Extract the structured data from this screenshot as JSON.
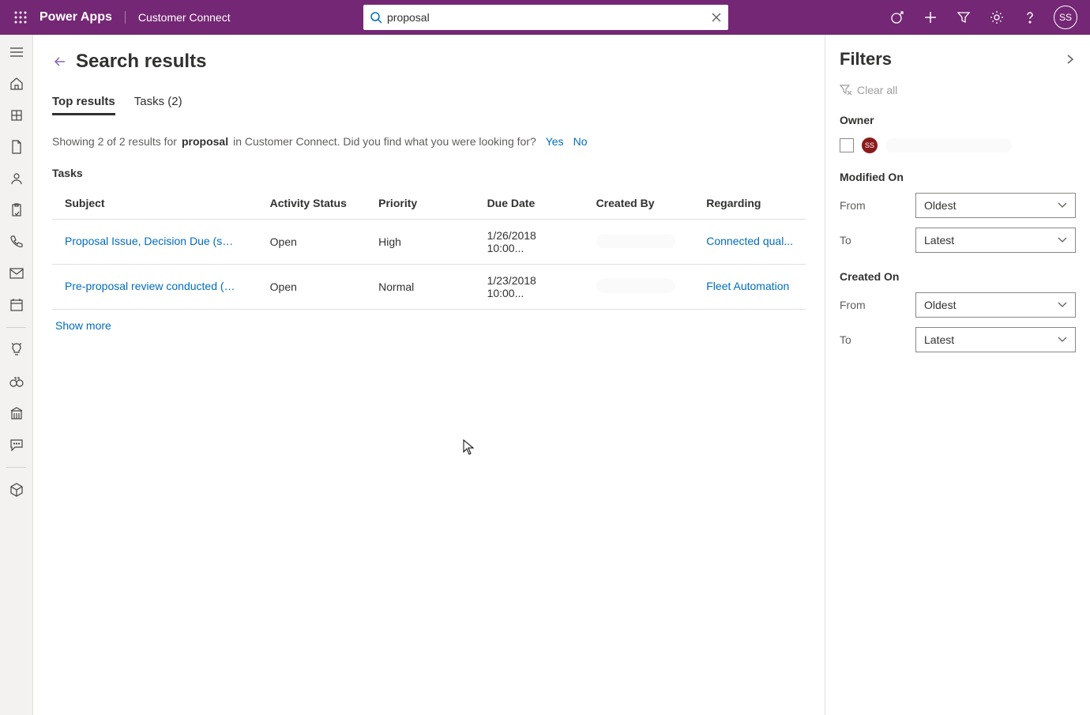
{
  "header": {
    "app_title": "Power Apps",
    "app_subtitle": "Customer Connect",
    "search_value": "proposal",
    "avatar_initials": "SS"
  },
  "page": {
    "title": "Search results",
    "tabs": [
      {
        "label": "Top results",
        "active": true
      },
      {
        "label": "Tasks (2)",
        "active": false
      }
    ],
    "result_info": {
      "prefix": "Showing 2 of 2 results for",
      "term": "proposal",
      "suffix": "in Customer Connect. Did you find what you were looking for?",
      "yes": "Yes",
      "no": "No"
    },
    "section_label": "Tasks",
    "columns": {
      "subject": "Subject",
      "activity_status": "Activity Status",
      "priority": "Priority",
      "due_date": "Due Date",
      "created_by": "Created By",
      "regarding": "Regarding"
    },
    "rows": [
      {
        "subject": "Proposal Issue, Decision Due (sampl...",
        "activity_status": "Open",
        "priority": "High",
        "due_date": "1/26/2018 10:00...",
        "created_by": "",
        "regarding": "Connected qual..."
      },
      {
        "subject": "Pre-proposal review conducted (sa...",
        "activity_status": "Open",
        "priority": "Normal",
        "due_date": "1/23/2018 10:00...",
        "created_by": "",
        "regarding": "Fleet Automation"
      }
    ],
    "show_more": "Show more"
  },
  "filters": {
    "title": "Filters",
    "clear_all": "Clear all",
    "owner_label": "Owner",
    "owner_initials": "SS",
    "modified_on_label": "Modified On",
    "created_on_label": "Created On",
    "from_label": "From",
    "to_label": "To",
    "oldest": "Oldest",
    "latest": "Latest"
  }
}
